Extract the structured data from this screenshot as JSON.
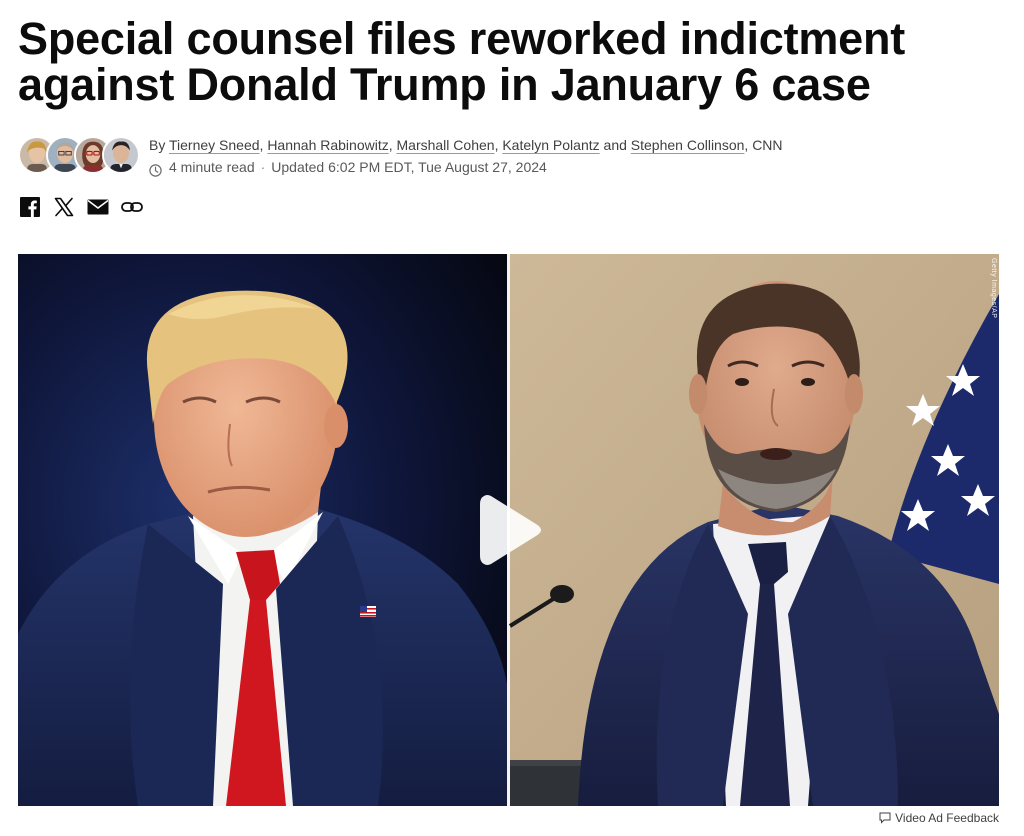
{
  "article": {
    "headline": "Special counsel files reworked indictment against Donald Trump in January 6 case",
    "byline_prefix": "By ",
    "authors": [
      {
        "name": "Tierney Sneed"
      },
      {
        "name": "Hannah Rabinowitz"
      },
      {
        "name": "Marshall Cohen"
      },
      {
        "name": "Katelyn Polantz"
      },
      {
        "name": "Stephen Collinson"
      }
    ],
    "separators": {
      "comma": ", ",
      "and": " and ",
      "outlet": ", CNN"
    },
    "read_time": "4 minute read",
    "meta_dot": "·",
    "updated": "Updated 6:02 PM EDT, Tue August 27, 2024"
  },
  "share": {
    "icons": [
      "facebook-icon",
      "x-icon",
      "email-icon",
      "link-icon"
    ]
  },
  "media": {
    "photo_credit": "Getty Images/AP",
    "feedback_label": "Video Ad Feedback",
    "icons": [
      "play-icon",
      "feedback-icon"
    ]
  },
  "colors": {
    "text": "#0c0c0c",
    "meta": "#595959",
    "suit_navy": "#1f2c55",
    "tie_red": "#d0161e"
  }
}
